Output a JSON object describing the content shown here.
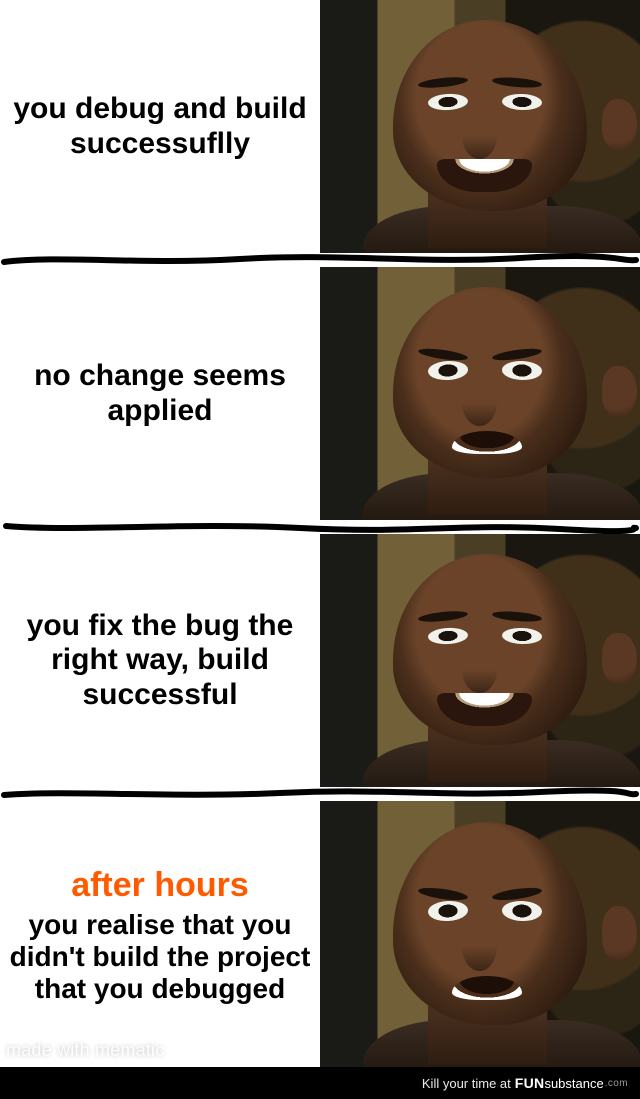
{
  "panels": [
    {
      "text": "you debug and build successuflly",
      "accent": "",
      "expression": "happy"
    },
    {
      "text": "no change seems applied",
      "accent": "",
      "expression": "sad"
    },
    {
      "text": "you fix the bug the right way, build successful",
      "accent": "",
      "expression": "happy"
    },
    {
      "text": "you realise that you didn't build the project that you debugged",
      "accent": "after hours",
      "expression": "sad"
    }
  ],
  "watermark": "made with mematic",
  "footer": {
    "lead": "Kill your time at",
    "brand_fun": "FUN",
    "brand_sub": "substance",
    "brand_com": ".com"
  }
}
